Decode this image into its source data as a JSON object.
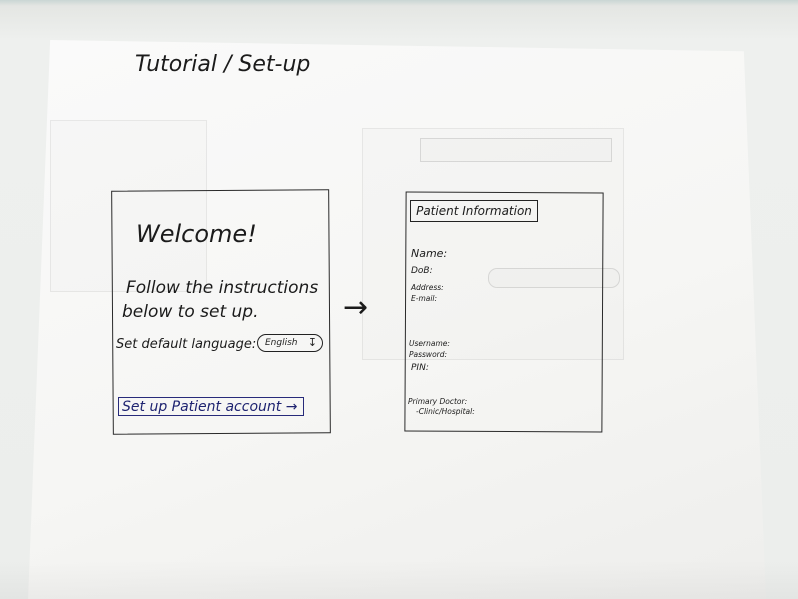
{
  "heading": "Tutorial / Set-up",
  "welcome_screen": {
    "title": "Welcome!",
    "instructions_line1": "Follow the instructions",
    "instructions_line2": "below to set up.",
    "language_label": "Set default language:",
    "language_value": "English",
    "setup_button_label": "Set up Patient account →"
  },
  "arrow": "→",
  "patient_screen": {
    "title": "Patient Information",
    "fields_personal": [
      "Name:",
      "DoB:",
      "Address:",
      "E-mail:"
    ],
    "fields_account": [
      "Username:",
      "Password:",
      "PIN:"
    ],
    "fields_doctor": [
      "Primary Doctor:",
      "-Clinic/Hospital:"
    ]
  },
  "colors": {
    "background_wall": "#7fd0cc",
    "paper": "#f6f6f4",
    "ink": "#1b1b1b",
    "button_ink": "#1e2370"
  },
  "icons": [
    "chevron-down-icon",
    "right-arrow-icon"
  ]
}
